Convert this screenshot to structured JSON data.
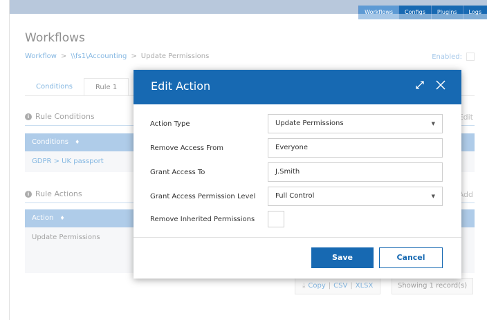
{
  "topnav": {
    "items": [
      "Workflows",
      "Configs",
      "Plugins",
      "Logs"
    ],
    "active": "Workflows"
  },
  "page": {
    "title": "Workflows",
    "breadcrumb": {
      "workflow": "Workflow",
      "separator": ">",
      "path": "\\\\fs1\\Accounting",
      "current": "Update Permissions"
    },
    "enabled_label": "Enabled:"
  },
  "tabs": [
    {
      "label": "Conditions"
    },
    {
      "label": "Rule 1"
    }
  ],
  "rule_conditions": {
    "title": "Rule Conditions",
    "side_label": "Edit",
    "column": "Conditions",
    "sort_icon": "♦",
    "row": "GDPR > UK passport"
  },
  "rule_actions": {
    "title": "Rule Actions",
    "side_label": "Add",
    "column": "Action",
    "sort_icon": "♦",
    "row": "Update Permissions"
  },
  "exports": {
    "copy": "Copy",
    "csv": "CSV",
    "xlsx": "XLSX",
    "sep": "|"
  },
  "records": "Showing 1 record(s)",
  "modal": {
    "title": "Edit Action",
    "fields": {
      "action_type": {
        "label": "Action Type",
        "value": "Update Permissions"
      },
      "remove_access_from": {
        "label": "Remove Access From",
        "value": "Everyone"
      },
      "grant_access_to": {
        "label": "Grant Access To",
        "value": "J.Smith"
      },
      "grant_level": {
        "label": "Grant Access Permission Level",
        "value": "Full Control"
      },
      "remove_inherited": {
        "label": "Remove Inherited Permissions",
        "checked": false
      }
    },
    "save_label": "Save",
    "cancel_label": "Cancel"
  },
  "colors": {
    "primary": "#1769b2",
    "grid_header": "#6da3d8",
    "link": "#1e7bc9"
  },
  "icons": {
    "caret": "▼",
    "info": "i",
    "download": "⤓"
  }
}
